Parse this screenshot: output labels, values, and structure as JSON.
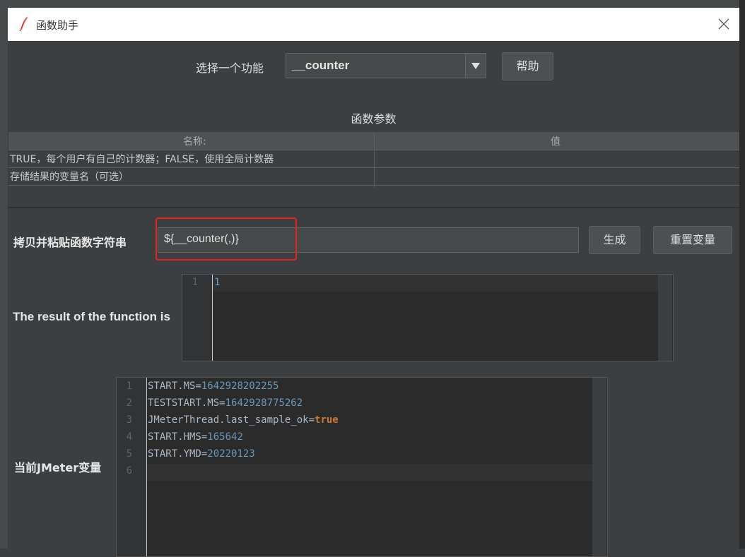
{
  "dialog": {
    "title": "函数助手"
  },
  "function_select": {
    "label": "选择一个功能",
    "value": "__counter",
    "help_button": "帮助"
  },
  "params": {
    "section_title": "函数参数",
    "headers": [
      "名称:",
      "值"
    ],
    "rows": [
      {
        "name": "TRUE，每个用户有自己的计数器；FALSE，使用全局计数器",
        "value": ""
      },
      {
        "name": "存储结果的变量名（可选）",
        "value": ""
      }
    ]
  },
  "copy_string": {
    "label": "拷贝并粘贴函数字符串",
    "value": "${__counter(,)}",
    "generate_button": "生成",
    "reset_button": "重置变量"
  },
  "result": {
    "label": "The result of the function is",
    "lines": [
      {
        "num": "1",
        "text": "1"
      }
    ]
  },
  "jmeter_vars": {
    "label": "当前JMeter变量",
    "lines": [
      {
        "num": "1",
        "key": "START.MS",
        "value": "1642928202255"
      },
      {
        "num": "2",
        "key": "TESTSTART.MS",
        "value": "1642928775262"
      },
      {
        "num": "3",
        "key": "JMeterThread.last_sample_ok",
        "value": "true"
      },
      {
        "num": "4",
        "key": "START.HMS",
        "value": "165642"
      },
      {
        "num": "5",
        "key": "START.YMD",
        "value": "20220123"
      },
      {
        "num": "6",
        "key": "",
        "value": ""
      }
    ]
  },
  "colors": {
    "highlight_box": "#e8231f",
    "number_value": "#6897bb",
    "keyword_value": "#cc7832"
  },
  "icons": [
    "feather-icon",
    "close-icon",
    "dropdown-arrow-icon"
  ]
}
